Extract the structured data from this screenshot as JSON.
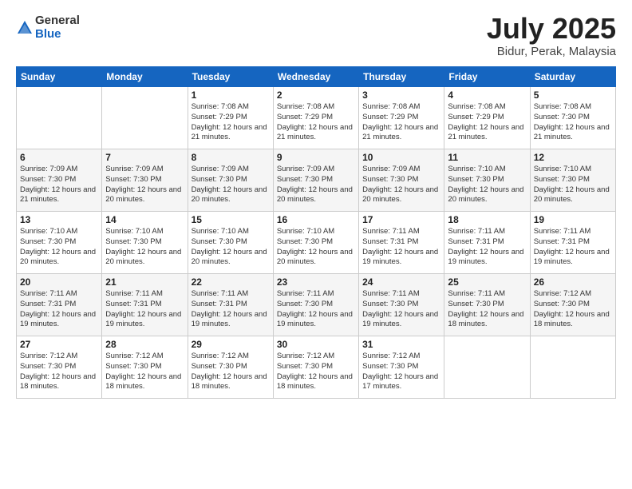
{
  "header": {
    "logo_general": "General",
    "logo_blue": "Blue",
    "month_title": "July 2025",
    "location": "Bidur, Perak, Malaysia"
  },
  "weekdays": [
    "Sunday",
    "Monday",
    "Tuesday",
    "Wednesday",
    "Thursday",
    "Friday",
    "Saturday"
  ],
  "weeks": [
    [
      {
        "day": "",
        "info": ""
      },
      {
        "day": "",
        "info": ""
      },
      {
        "day": "1",
        "info": "Sunrise: 7:08 AM\nSunset: 7:29 PM\nDaylight: 12 hours and 21 minutes."
      },
      {
        "day": "2",
        "info": "Sunrise: 7:08 AM\nSunset: 7:29 PM\nDaylight: 12 hours and 21 minutes."
      },
      {
        "day": "3",
        "info": "Sunrise: 7:08 AM\nSunset: 7:29 PM\nDaylight: 12 hours and 21 minutes."
      },
      {
        "day": "4",
        "info": "Sunrise: 7:08 AM\nSunset: 7:29 PM\nDaylight: 12 hours and 21 minutes."
      },
      {
        "day": "5",
        "info": "Sunrise: 7:08 AM\nSunset: 7:30 PM\nDaylight: 12 hours and 21 minutes."
      }
    ],
    [
      {
        "day": "6",
        "info": "Sunrise: 7:09 AM\nSunset: 7:30 PM\nDaylight: 12 hours and 21 minutes."
      },
      {
        "day": "7",
        "info": "Sunrise: 7:09 AM\nSunset: 7:30 PM\nDaylight: 12 hours and 20 minutes."
      },
      {
        "day": "8",
        "info": "Sunrise: 7:09 AM\nSunset: 7:30 PM\nDaylight: 12 hours and 20 minutes."
      },
      {
        "day": "9",
        "info": "Sunrise: 7:09 AM\nSunset: 7:30 PM\nDaylight: 12 hours and 20 minutes."
      },
      {
        "day": "10",
        "info": "Sunrise: 7:09 AM\nSunset: 7:30 PM\nDaylight: 12 hours and 20 minutes."
      },
      {
        "day": "11",
        "info": "Sunrise: 7:10 AM\nSunset: 7:30 PM\nDaylight: 12 hours and 20 minutes."
      },
      {
        "day": "12",
        "info": "Sunrise: 7:10 AM\nSunset: 7:30 PM\nDaylight: 12 hours and 20 minutes."
      }
    ],
    [
      {
        "day": "13",
        "info": "Sunrise: 7:10 AM\nSunset: 7:30 PM\nDaylight: 12 hours and 20 minutes."
      },
      {
        "day": "14",
        "info": "Sunrise: 7:10 AM\nSunset: 7:30 PM\nDaylight: 12 hours and 20 minutes."
      },
      {
        "day": "15",
        "info": "Sunrise: 7:10 AM\nSunset: 7:30 PM\nDaylight: 12 hours and 20 minutes."
      },
      {
        "day": "16",
        "info": "Sunrise: 7:10 AM\nSunset: 7:30 PM\nDaylight: 12 hours and 20 minutes."
      },
      {
        "day": "17",
        "info": "Sunrise: 7:11 AM\nSunset: 7:31 PM\nDaylight: 12 hours and 19 minutes."
      },
      {
        "day": "18",
        "info": "Sunrise: 7:11 AM\nSunset: 7:31 PM\nDaylight: 12 hours and 19 minutes."
      },
      {
        "day": "19",
        "info": "Sunrise: 7:11 AM\nSunset: 7:31 PM\nDaylight: 12 hours and 19 minutes."
      }
    ],
    [
      {
        "day": "20",
        "info": "Sunrise: 7:11 AM\nSunset: 7:31 PM\nDaylight: 12 hours and 19 minutes."
      },
      {
        "day": "21",
        "info": "Sunrise: 7:11 AM\nSunset: 7:31 PM\nDaylight: 12 hours and 19 minutes."
      },
      {
        "day": "22",
        "info": "Sunrise: 7:11 AM\nSunset: 7:31 PM\nDaylight: 12 hours and 19 minutes."
      },
      {
        "day": "23",
        "info": "Sunrise: 7:11 AM\nSunset: 7:30 PM\nDaylight: 12 hours and 19 minutes."
      },
      {
        "day": "24",
        "info": "Sunrise: 7:11 AM\nSunset: 7:30 PM\nDaylight: 12 hours and 19 minutes."
      },
      {
        "day": "25",
        "info": "Sunrise: 7:11 AM\nSunset: 7:30 PM\nDaylight: 12 hours and 18 minutes."
      },
      {
        "day": "26",
        "info": "Sunrise: 7:12 AM\nSunset: 7:30 PM\nDaylight: 12 hours and 18 minutes."
      }
    ],
    [
      {
        "day": "27",
        "info": "Sunrise: 7:12 AM\nSunset: 7:30 PM\nDaylight: 12 hours and 18 minutes."
      },
      {
        "day": "28",
        "info": "Sunrise: 7:12 AM\nSunset: 7:30 PM\nDaylight: 12 hours and 18 minutes."
      },
      {
        "day": "29",
        "info": "Sunrise: 7:12 AM\nSunset: 7:30 PM\nDaylight: 12 hours and 18 minutes."
      },
      {
        "day": "30",
        "info": "Sunrise: 7:12 AM\nSunset: 7:30 PM\nDaylight: 12 hours and 18 minutes."
      },
      {
        "day": "31",
        "info": "Sunrise: 7:12 AM\nSunset: 7:30 PM\nDaylight: 12 hours and 17 minutes."
      },
      {
        "day": "",
        "info": ""
      },
      {
        "day": "",
        "info": ""
      }
    ]
  ]
}
